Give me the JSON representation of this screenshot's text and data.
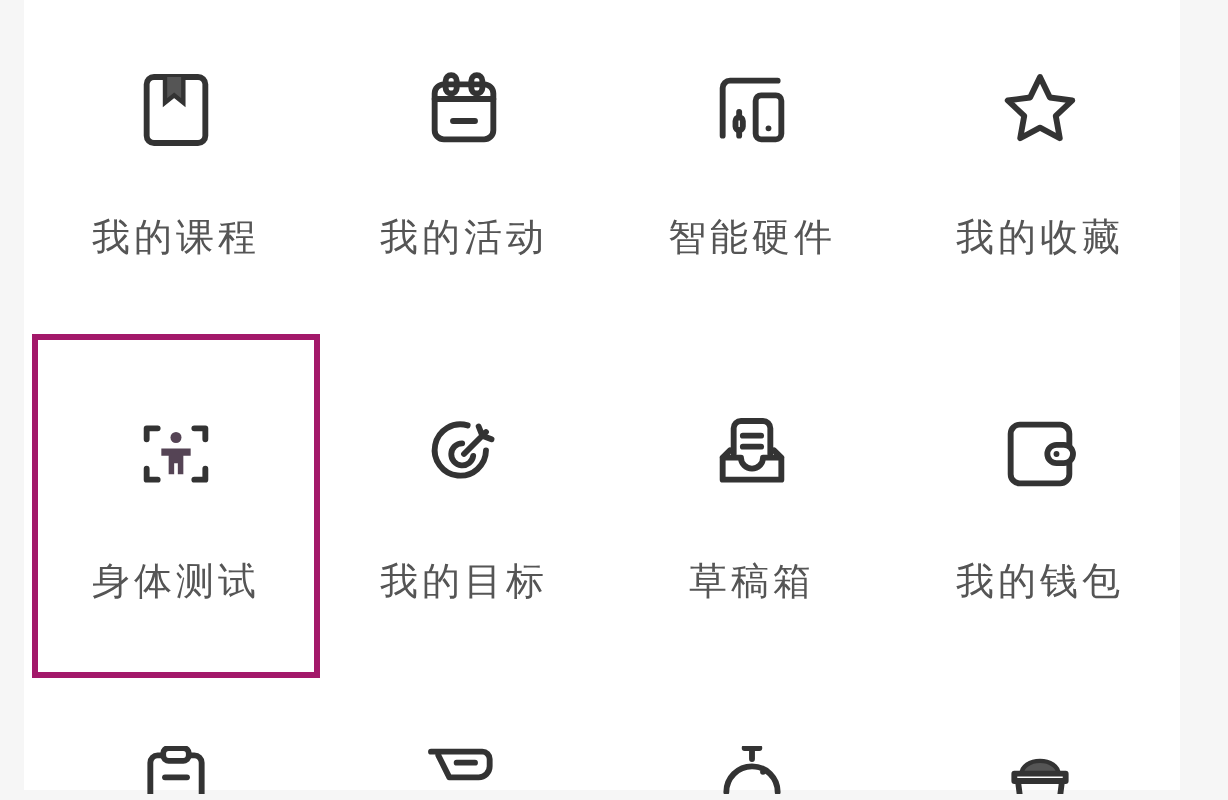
{
  "grid": [
    {
      "label": "我的课程",
      "selected": false
    },
    {
      "label": "我的活动",
      "selected": false
    },
    {
      "label": "智能硬件",
      "selected": false
    },
    {
      "label": "我的收藏",
      "selected": false
    },
    {
      "label": "身体测试",
      "selected": true
    },
    {
      "label": "我的目标",
      "selected": false
    },
    {
      "label": "草稿箱",
      "selected": false
    },
    {
      "label": "我的钱包",
      "selected": false
    },
    {
      "selected": false
    },
    {
      "selected": false
    },
    {
      "selected": false
    },
    {
      "selected": false
    }
  ]
}
